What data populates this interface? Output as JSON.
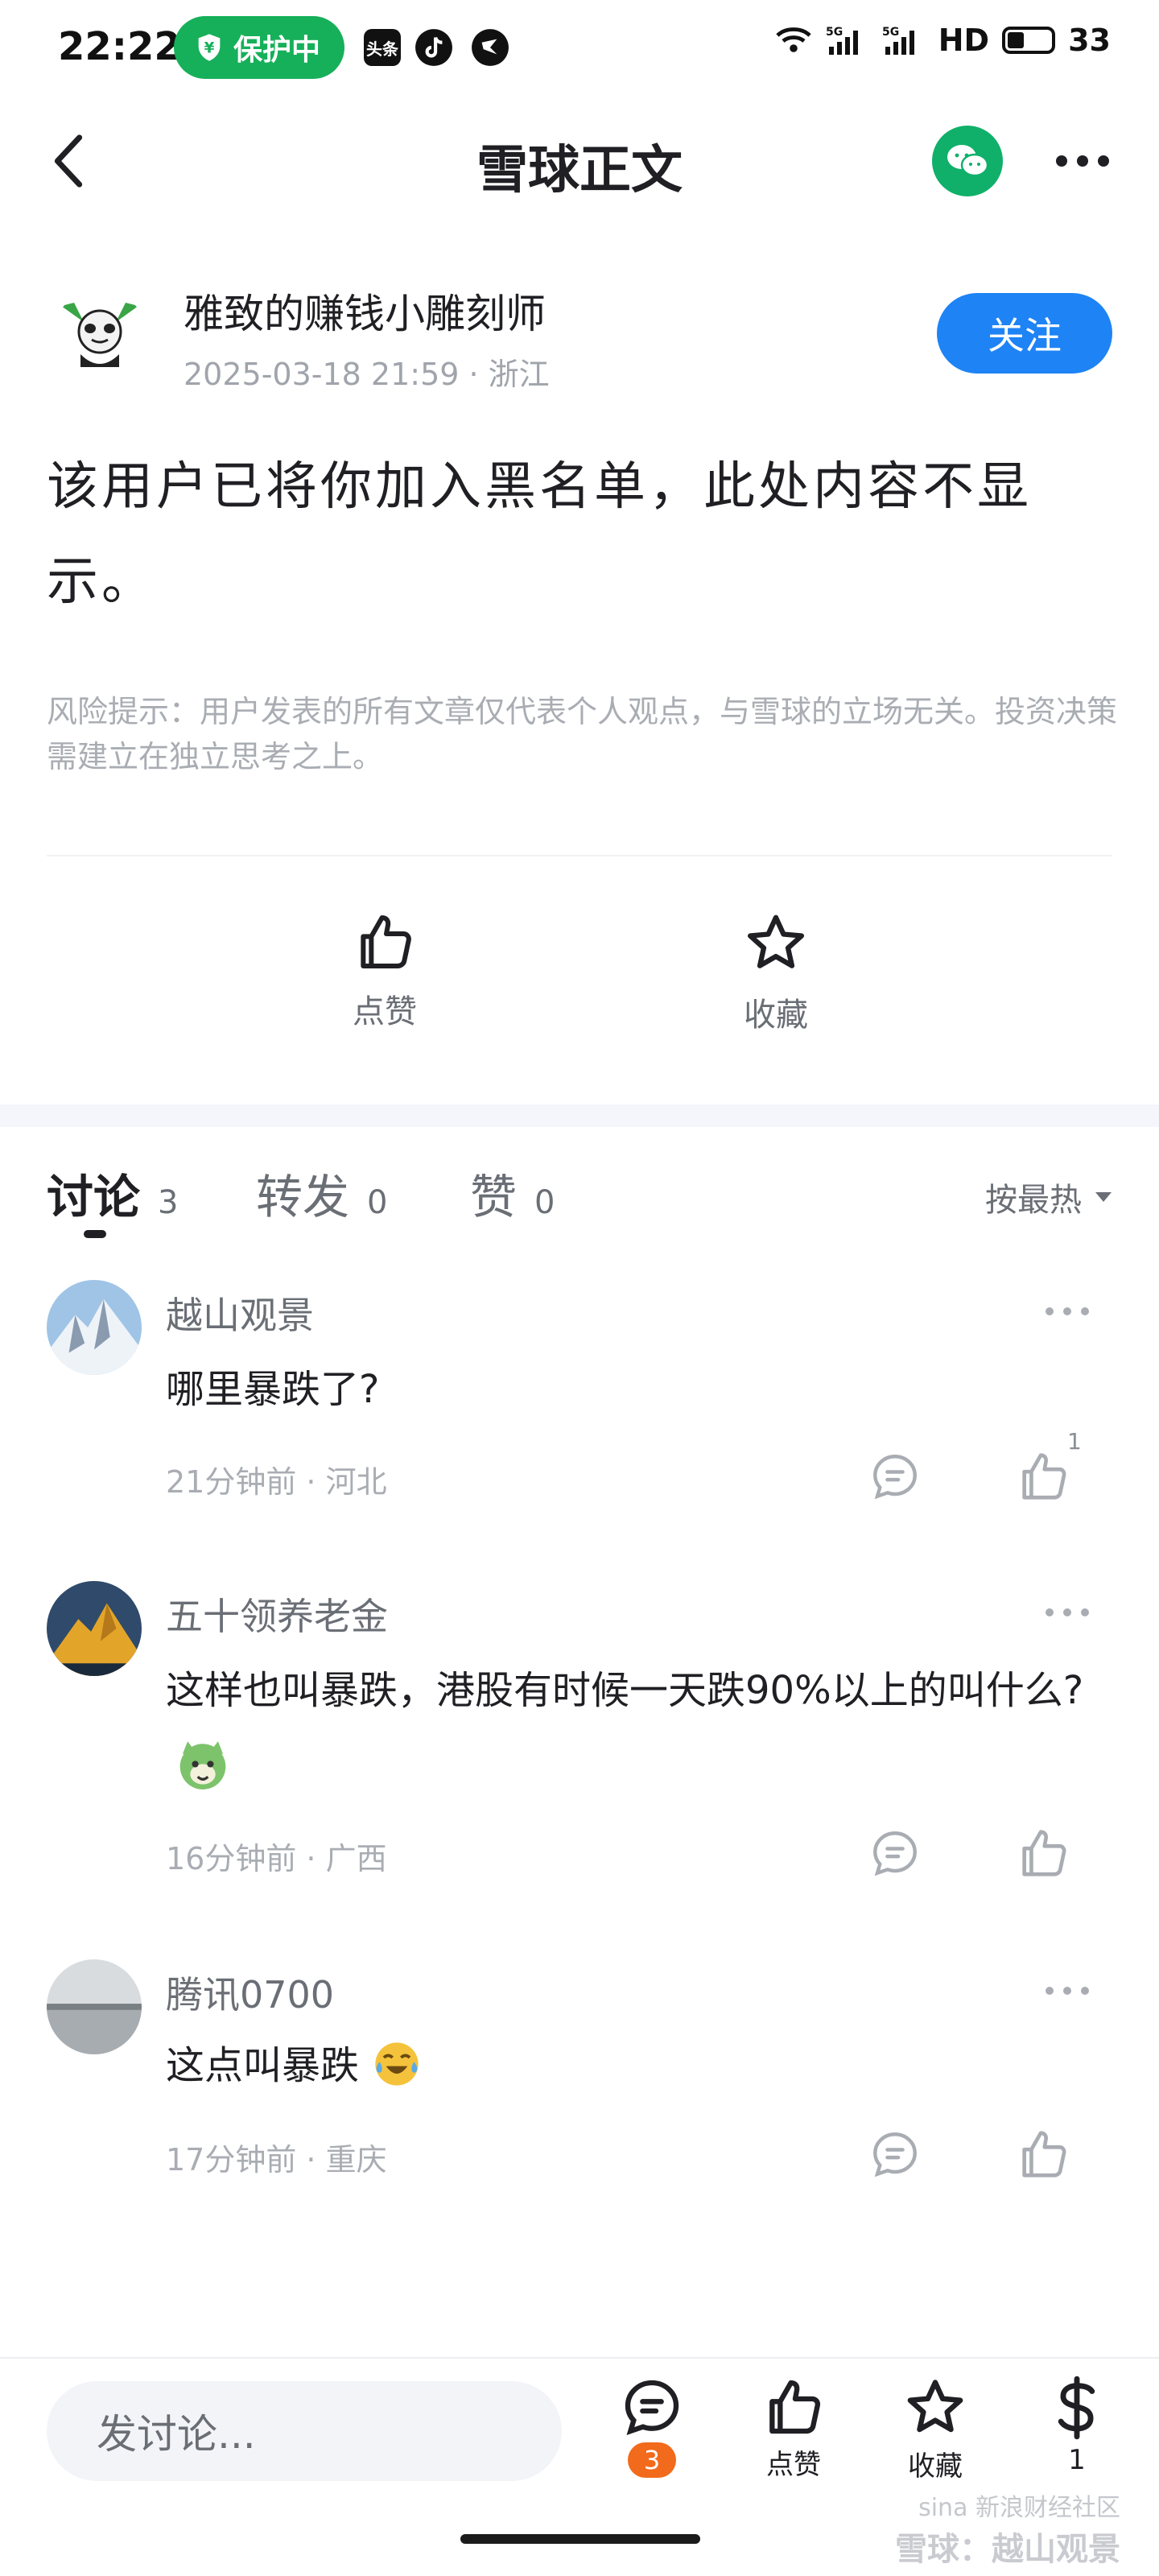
{
  "status_bar": {
    "time": "22:22",
    "protection_label": "保护中",
    "app_badge_toutiao": "头条",
    "network_label": "HD",
    "battery_level": "33"
  },
  "header": {
    "title": "雪球正文"
  },
  "post": {
    "author_name": "雅致的赚钱小雕刻师",
    "meta": "2025-03-18 21:59 · 浙江",
    "follow_label": "关注",
    "content": "该用户已将你加入黑名单，此处内容不显示。",
    "risk_note": "风险提示：用户发表的所有文章仅代表个人观点，与雪球的立场无关。投资决策需建立在独立思考之上。",
    "actions": {
      "like_label": "点赞",
      "favorite_label": "收藏"
    }
  },
  "tabs": [
    {
      "label": "讨论",
      "count": "3",
      "active": true
    },
    {
      "label": "转发",
      "count": "0",
      "active": false
    },
    {
      "label": "赞",
      "count": "0",
      "active": false
    }
  ],
  "sort_label": "按最热",
  "comments": [
    {
      "name": "越山观景",
      "text": "哪里暴跌了?",
      "meta": "21分钟前 · 河北",
      "like_count": "1"
    },
    {
      "name": "五十领养老金",
      "text": "这样也叫暴跌，港股有时候一天跌90%以上的叫什么?",
      "meta": "16分钟前 · 广西",
      "like_count": ""
    },
    {
      "name": "腾讯0700",
      "text": "这点叫暴跌",
      "meta": "17分钟前 · 重庆",
      "like_count": ""
    }
  ],
  "bottom_bar": {
    "input_placeholder": "发讨论...",
    "comment_badge": "3",
    "like_label": "点赞",
    "favorite_label": "收藏",
    "reward_count": "1"
  },
  "watermark": {
    "line1": "sina 新浪财经社区",
    "line2": "雪球：越山观景"
  },
  "colors": {
    "accent_blue": "#1e83f5",
    "protect_green": "#16b05a",
    "wechat_green": "#10b06a",
    "badge_orange": "#f26a1b"
  }
}
